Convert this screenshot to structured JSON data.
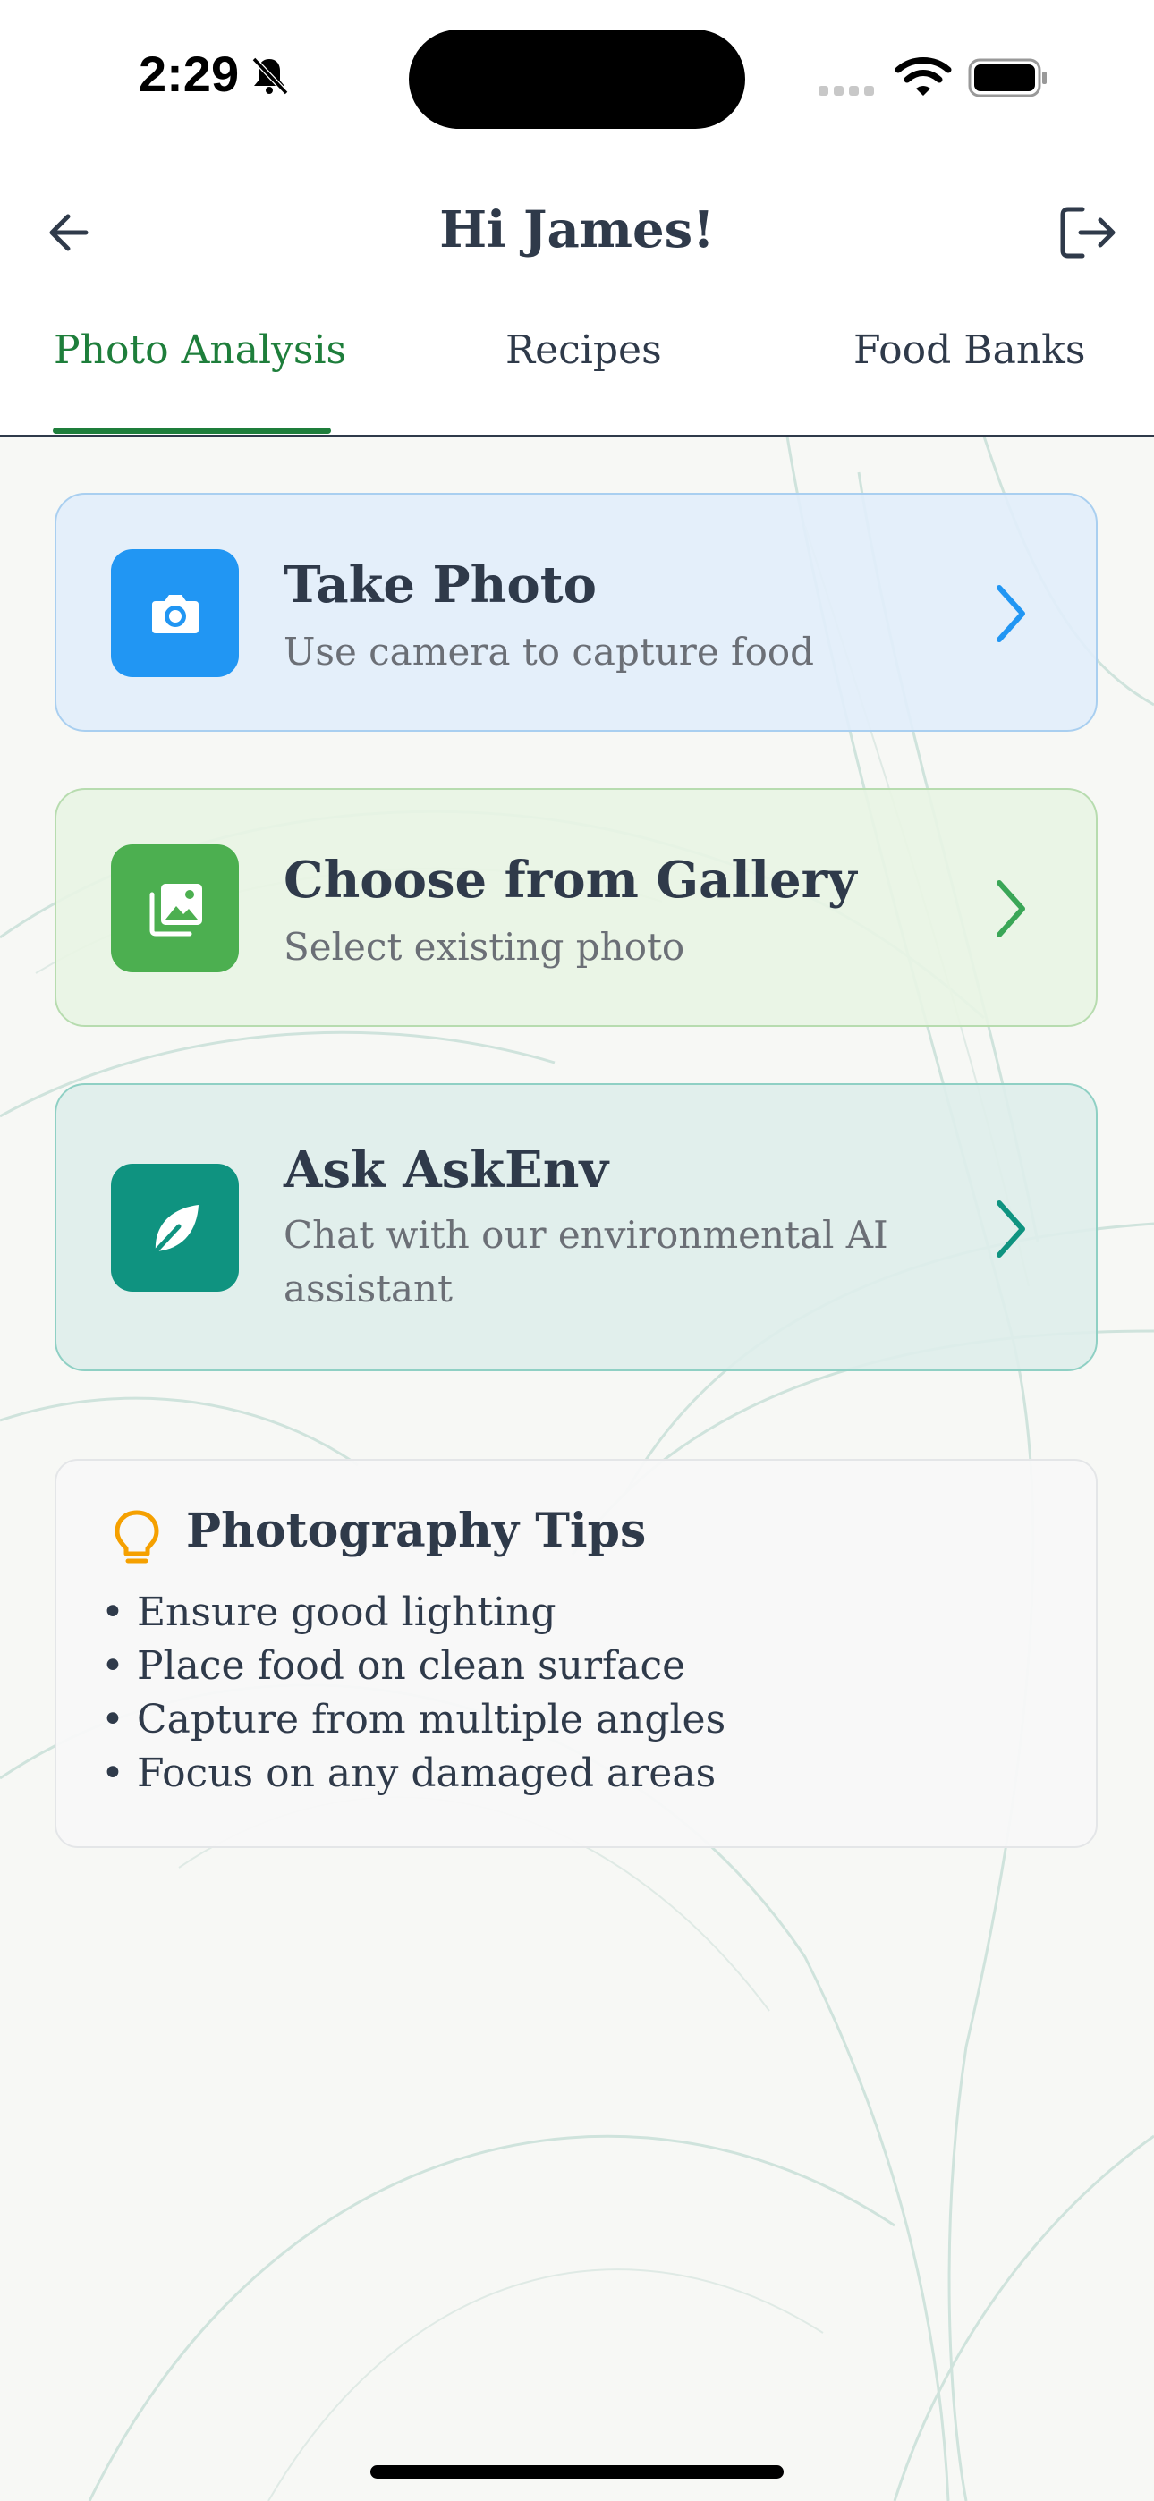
{
  "status_bar": {
    "time": "2:29"
  },
  "header": {
    "title": "Hi James!"
  },
  "tabs": [
    {
      "label": "Photo Analysis",
      "active": true
    },
    {
      "label": "Recipes",
      "active": false
    },
    {
      "label": "Food Banks",
      "active": false
    }
  ],
  "cards": {
    "take_photo": {
      "title": "Take Photo",
      "subtitle": "Use camera to capture food",
      "icon": "camera-icon",
      "color": "#2196f3"
    },
    "gallery": {
      "title": "Choose from Gallery",
      "subtitle": "Select existing photo",
      "icon": "gallery-icon",
      "color": "#4caf50"
    },
    "ask": {
      "title": "Ask AskEnv",
      "subtitle": "Chat with our environmental AI assistant",
      "icon": "leaf-icon",
      "color": "#0f9380"
    }
  },
  "tips": {
    "title": "Photography Tips",
    "items": [
      "• Ensure good lighting",
      "• Place food on clean surface",
      "• Capture from multiple angles",
      "• Focus on any damaged areas"
    ]
  },
  "colors": {
    "accent": "#1e7e3b",
    "text": "#2f3a4a",
    "tip_icon": "#f5a000"
  }
}
